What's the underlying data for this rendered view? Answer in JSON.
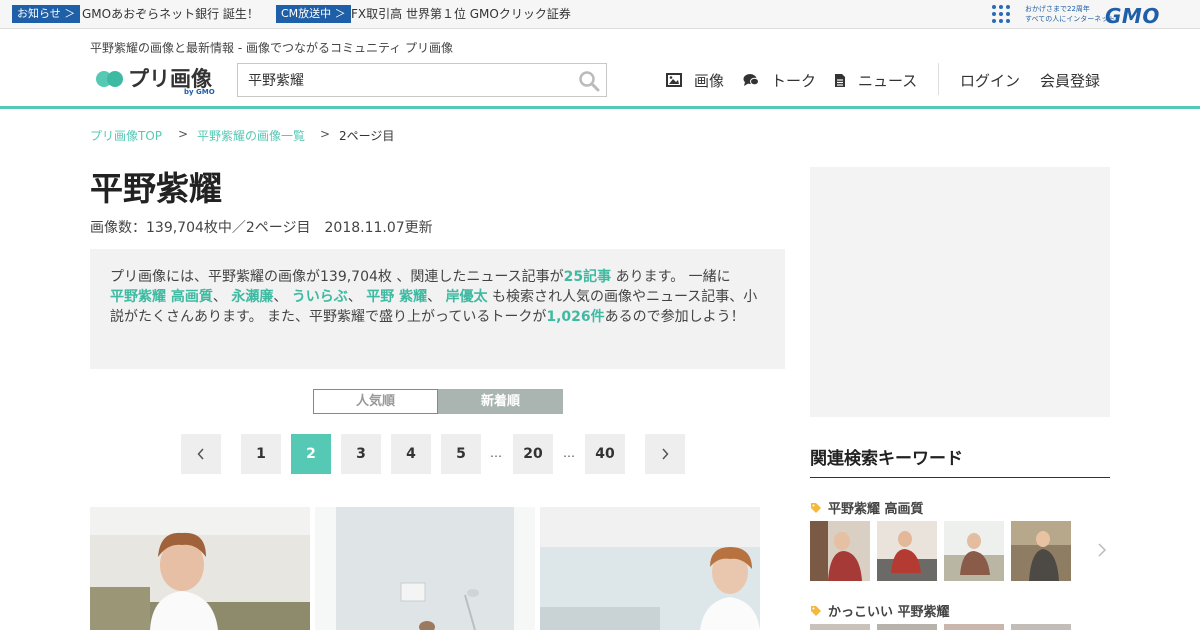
{
  "topbar": {
    "badge1": "お知らせ ＞",
    "text1": "GMOあおぞらネット銀行 誕生！",
    "badge2": "CM放送中 ＞",
    "text2": "FX取引高 世界第１位 GMOクリック証券",
    "tag_line1": "おかげさまで22周年",
    "tag_line2": "すべての人にインターネット",
    "gmo_logo": "GMO"
  },
  "header": {
    "tagline": "平野紫耀の画像と最新情報 - 画像でつながるコミュニティ プリ画像",
    "logo_text": "プリ画像",
    "logo_by": "by GMO",
    "search_value": "平野紫耀",
    "nav": {
      "images": "画像",
      "talk": "トーク",
      "news": "ニュース",
      "login": "ログイン",
      "register": "会員登録"
    }
  },
  "breadcrumb": {
    "home": "プリ画像TOP",
    "list": "平野紫耀の画像一覧",
    "current": "2ページ目",
    "sep": ">"
  },
  "main": {
    "title": "平野紫耀",
    "meta": "画像数：139,704枚中／2ページ目　2018.11.07更新",
    "desc": {
      "p1": "プリ画像には、平野紫耀の画像が139,704枚 、関連したニュース記事が",
      "news_count": "25記事",
      "p2": " あります。 一緒に",
      "kw1": "平野紫耀 高画質",
      "kw2": "永瀬廉",
      "kw3": "ういらぶ",
      "kw4": "平野 紫耀",
      "kw5": "岸優太",
      "sep": "、",
      "p3": " も検索され人気の画像やニュース記事、小説がたくさんあります。 また、平野紫耀で盛り上がっているトークが",
      "talk_count": "1,026件",
      "p4": "あるので参加しよう！"
    },
    "sort": {
      "popular": "人気順",
      "newest": "新着順"
    },
    "pagination": {
      "p1": "1",
      "p2": "2",
      "p3": "3",
      "p4": "4",
      "p5": "5",
      "p20": "20",
      "p40": "40",
      "ellipsis": "…"
    }
  },
  "sidebar": {
    "related_title": "関連検索キーワード",
    "kw1": "平野紫耀 高画質",
    "kw2": "かっこいい 平野紫耀"
  },
  "colors": {
    "accent": "#55c9b4",
    "gmo_blue": "#1f5fa8"
  }
}
